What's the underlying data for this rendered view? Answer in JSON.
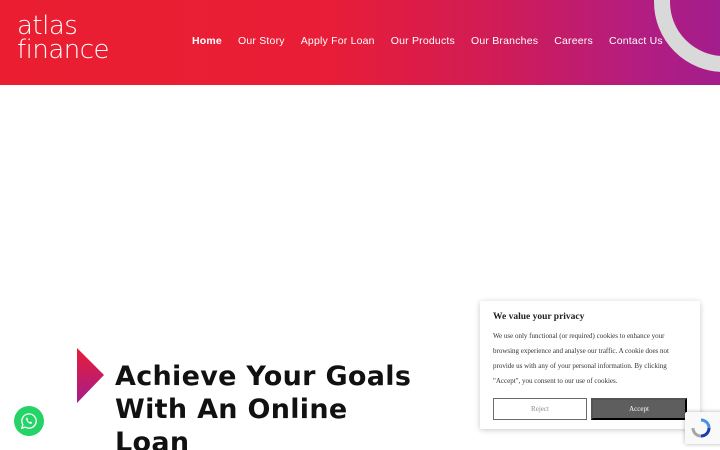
{
  "brand": {
    "line1": "atlas",
    "line2": "finance"
  },
  "nav": [
    {
      "label": "Home"
    },
    {
      "label": "Our Story"
    },
    {
      "label": "Apply For Loan"
    },
    {
      "label": "Our Products"
    },
    {
      "label": "Our Branches"
    },
    {
      "label": "Careers"
    },
    {
      "label": "Contact Us"
    }
  ],
  "hero": {
    "title": "Achieve Your Goals With An Online Loan"
  },
  "cookie": {
    "title": "We value your privacy",
    "body": "We use only functional (or required) cookies to enhance your browsing experience and analyse our traffic. A cookie does not provide us with any of your personal information. By clicking \"Accept\", you consent to our use of cookies.",
    "reject_label": "Reject",
    "accept_label": "Accept"
  },
  "icons": {
    "chat": "whatsapp-icon",
    "captcha": "recaptcha-icon"
  },
  "colors": {
    "brand_red": "#ea1e30",
    "brand_magenta": "#a31d8c",
    "whatsapp": "#25d366"
  }
}
